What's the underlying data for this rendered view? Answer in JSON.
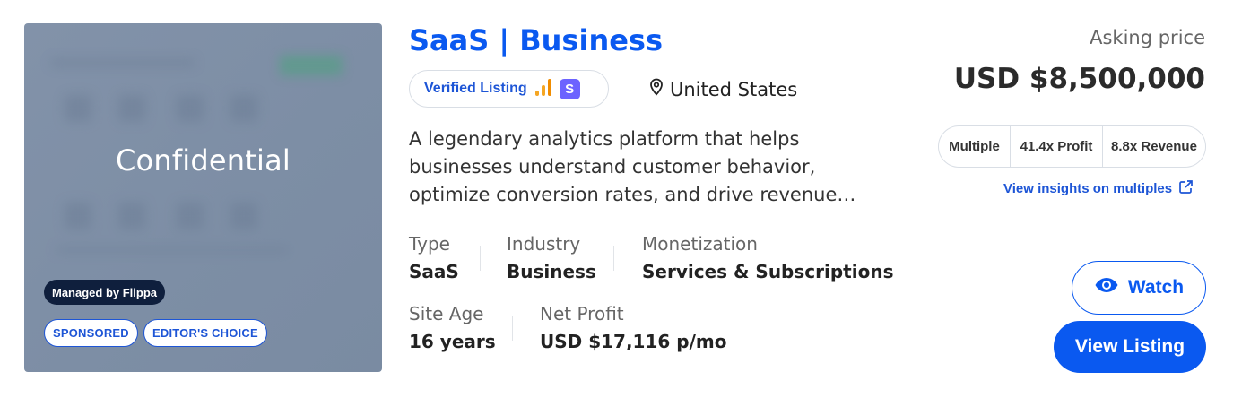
{
  "thumbnail": {
    "overlay_text": "Confidential",
    "managed_badge": "Managed by Flippa",
    "tags": [
      "SPONSORED",
      "EDITOR'S CHOICE"
    ]
  },
  "listing": {
    "title": "SaaS | Business",
    "verified_label": "Verified Listing",
    "verified_badge_letter": "S",
    "location": "United States",
    "description_lines": [
      "A legendary analytics platform that helps",
      "businesses understand customer behavior,",
      "optimize conversion rates, and drive revenue…"
    ]
  },
  "stats": {
    "type": {
      "label": "Type",
      "value": "SaaS"
    },
    "industry": {
      "label": "Industry",
      "value": "Business"
    },
    "monetization": {
      "label": "Monetization",
      "value": "Services & Subscriptions"
    },
    "site_age": {
      "label": "Site Age",
      "value": "16 years"
    },
    "net_profit": {
      "label": "Net Profit",
      "value": "USD $17,116 p/mo"
    }
  },
  "pricing": {
    "asking_label": "Asking price",
    "asking_value": "USD $8,500,000",
    "multiples": [
      "Multiple",
      "41.4x Profit",
      "8.8x Revenue"
    ],
    "insights_link": "View insights on multiples"
  },
  "actions": {
    "watch_label": "Watch",
    "view_label": "View Listing"
  },
  "colors": {
    "accent": "#0a59f0",
    "link": "#1d55d6",
    "badge_dark": "#0f1f3d",
    "badge_purple": "#6c63ff",
    "chart_orange": "#f5a623"
  }
}
